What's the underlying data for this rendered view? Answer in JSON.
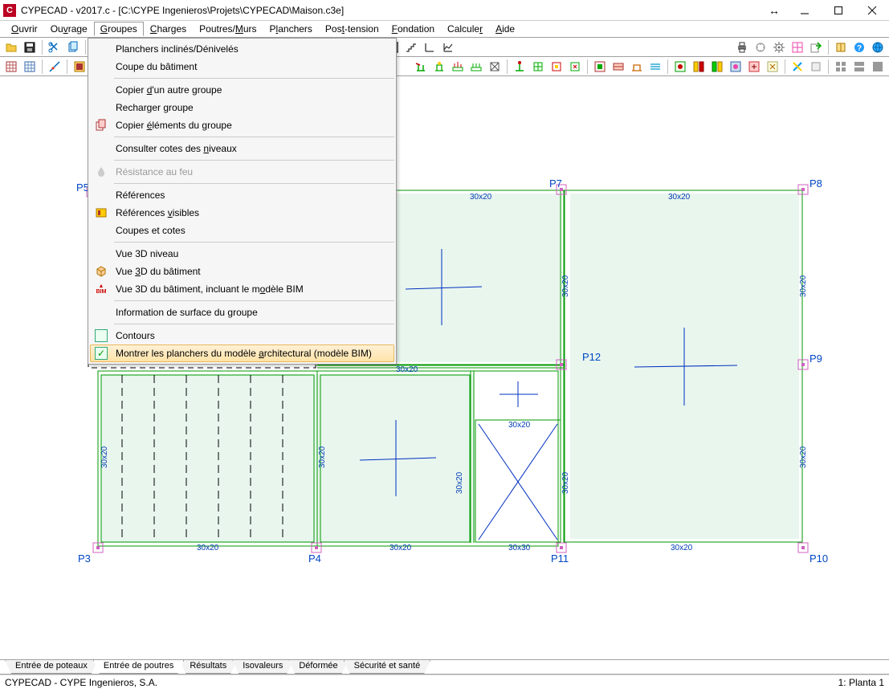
{
  "window": {
    "title": "CYPECAD - v2017.c - [C:\\CYPE Ingenieros\\Projets\\CYPECAD\\Maison.c3e]"
  },
  "menus": {
    "ouvrir": "Ouvrir",
    "ouvrage": "Ouvrage",
    "groupes": "Groupes",
    "charges": "Charges",
    "poutres": "Poutres/Murs",
    "planchers": "Planchers",
    "post": "Post-tension",
    "fondation": "Fondation",
    "calculer": "Calculer",
    "aide": "Aide"
  },
  "dropdown": {
    "items": [
      {
        "label": "Planchers inclinés/Dénivelés",
        "icon": "none",
        "type": "item"
      },
      {
        "label": "Coupe du bâtiment",
        "icon": "none",
        "type": "item"
      },
      {
        "type": "sep"
      },
      {
        "label": "Copier d'un autre groupe",
        "icon": "none",
        "type": "item",
        "u": [
          9,
          10
        ]
      },
      {
        "label": "Recharger groupe",
        "icon": "none",
        "type": "item"
      },
      {
        "label": "Copier éléments du groupe",
        "icon": "copy-icon",
        "type": "item",
        "u": [
          7,
          8
        ]
      },
      {
        "type": "sep"
      },
      {
        "label": "Consulter cotes des niveaux",
        "icon": "none",
        "type": "item",
        "u": [
          20,
          21
        ]
      },
      {
        "type": "sep"
      },
      {
        "label": "Résistance au feu",
        "icon": "fire-icon",
        "type": "item",
        "disabled": true
      },
      {
        "type": "sep"
      },
      {
        "label": "Références",
        "icon": "none",
        "type": "item"
      },
      {
        "label": "Références visibles",
        "icon": "visible-icon",
        "type": "item",
        "u": [
          11,
          12
        ]
      },
      {
        "label": "Coupes et cotes",
        "icon": "none",
        "type": "item"
      },
      {
        "type": "sep"
      },
      {
        "label": "Vue 3D niveau",
        "icon": "none",
        "type": "item"
      },
      {
        "label": "Vue 3D du bâtiment",
        "icon": "cube-icon",
        "type": "item",
        "u": [
          4,
          5
        ]
      },
      {
        "label": "Vue 3D du bâtiment, incluant le modèle BIM",
        "icon": "bim-icon",
        "type": "item",
        "u": [
          32,
          33
        ]
      },
      {
        "type": "sep"
      },
      {
        "label": "Information de surface du groupe",
        "icon": "none",
        "type": "item"
      },
      {
        "type": "sep"
      },
      {
        "label": "Contours",
        "icon": "chk-empty",
        "type": "item"
      },
      {
        "label": "Montrer les planchers du modèle architectural (modèle BIM)",
        "icon": "chk",
        "type": "item",
        "highlight": true,
        "u": [
          33,
          34
        ]
      }
    ]
  },
  "canvas": {
    "nodes": {
      "P3": "P3",
      "P4": "P4",
      "P5": "P5",
      "P7": "P7",
      "P8": "P8",
      "P9": "P9",
      "P10": "P10",
      "P11": "P11",
      "P12": "P12"
    },
    "beams": {
      "d30x20": "30x20",
      "d30x30": "30x30"
    }
  },
  "tabs": {
    "t1": "Entrée de poteaux",
    "t2": "Entrée de poutres",
    "t3": "Résultats",
    "t4": "Isovaleurs",
    "t5": "Déformée",
    "t6": "Sécurité et santé"
  },
  "status": {
    "left": "CYPECAD - CYPE Ingenieros, S.A.",
    "right": "1: Planta 1"
  }
}
